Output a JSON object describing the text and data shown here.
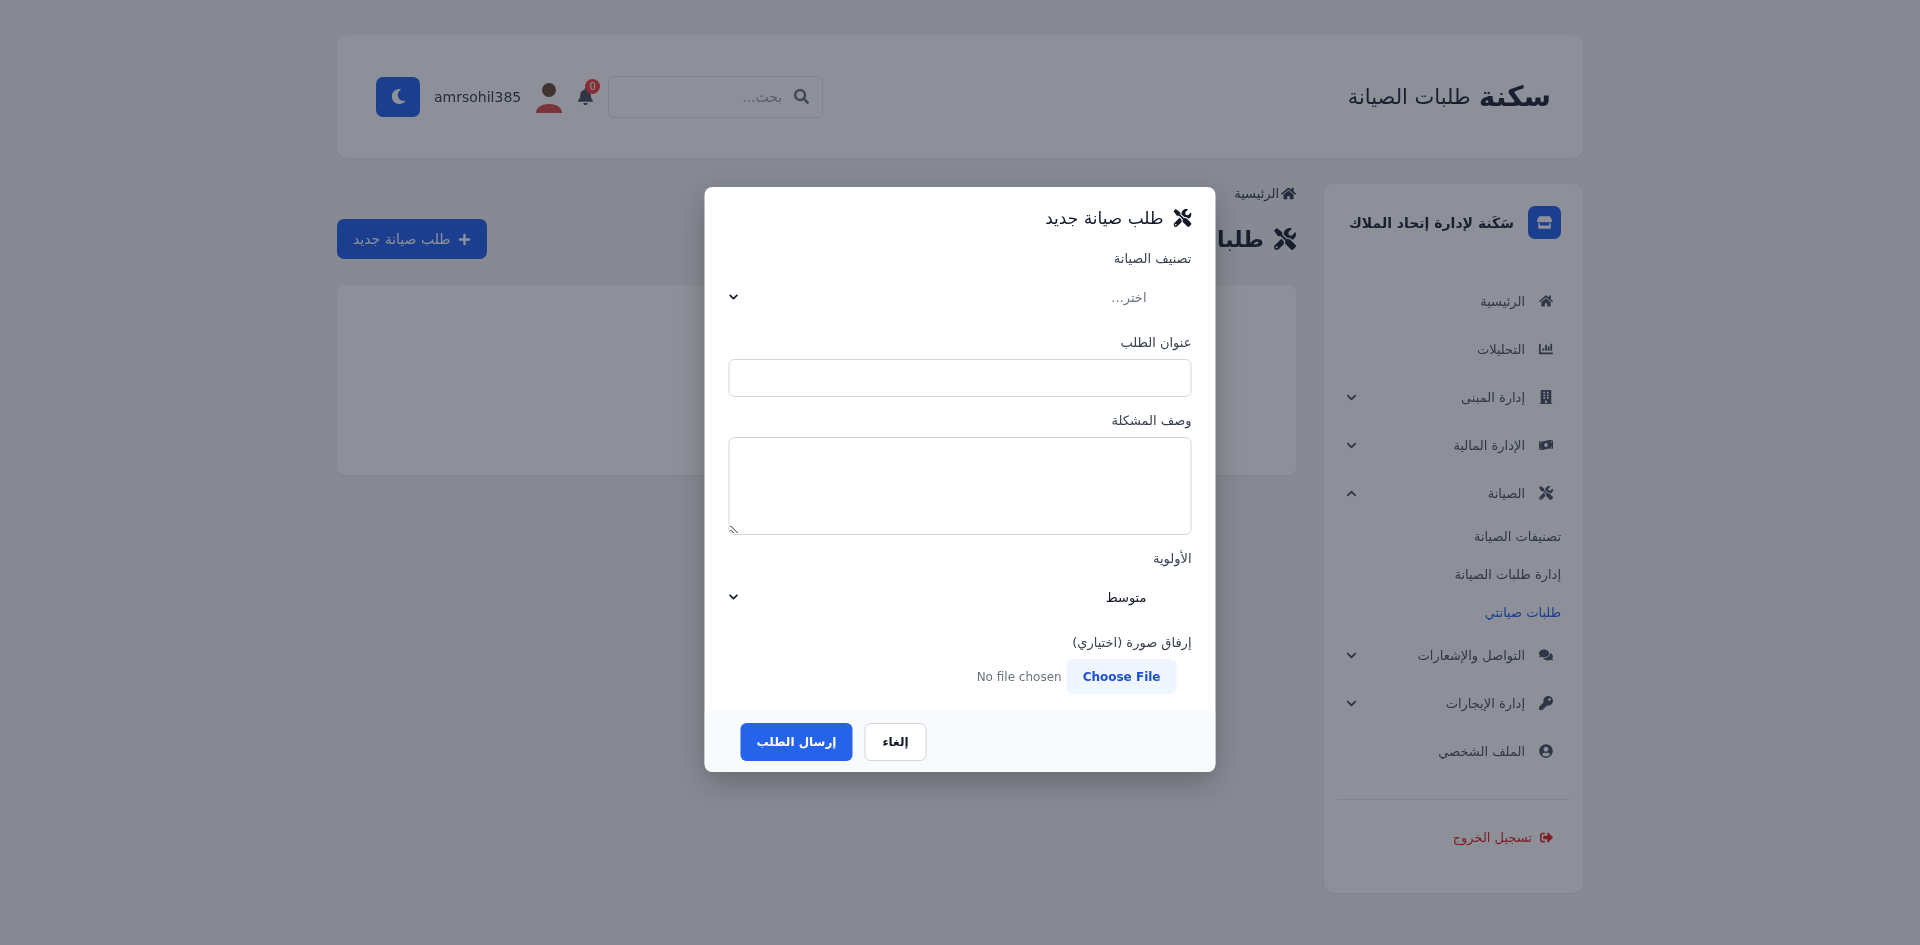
{
  "header": {
    "logo": "سكنة",
    "title": "طلبات الصيانة",
    "search": {
      "placeholder": "بحث..."
    },
    "notifications": "0",
    "username": "amrsohil385"
  },
  "sidebar": {
    "brand": "سَكَنة لإدارة إتحاد الملاك",
    "items": [
      {
        "label": "الرئيسية",
        "kind": "link",
        "selected": false
      },
      {
        "label": "التحليلات",
        "kind": "link",
        "selected": false
      },
      {
        "label": "إدارة المبنى",
        "kind": "group",
        "selected": false,
        "expanded": false
      },
      {
        "label": "الإدارة المالية",
        "kind": "group",
        "selected": false,
        "expanded": false
      },
      {
        "label": "الصيانة",
        "kind": "group",
        "selected": false,
        "expanded": true,
        "children": [
          {
            "label": "تصنيفات الصيانة",
            "selected": false
          },
          {
            "label": "إدارة طلبات الصيانة",
            "selected": false
          },
          {
            "label": "طلبات صيانتي",
            "selected": true
          }
        ]
      },
      {
        "label": "التواصل والإشعارات",
        "kind": "group",
        "selected": false,
        "expanded": false
      },
      {
        "label": "إدارة الإيجارات",
        "kind": "group",
        "selected": false,
        "expanded": false
      },
      {
        "label": "الملف الشخصي",
        "kind": "link",
        "selected": false
      }
    ],
    "logout": "تسجيل الخروج"
  },
  "breadcrumb": "الرئيسية",
  "page_title": "طلبا",
  "new_button": "طلب صيانة جديد",
  "modal": {
    "title": "طلب صيانة جديد",
    "fields": [
      {
        "kind": "select",
        "label": "تصنيف الصيانة",
        "placeholder": "اختر..."
      },
      {
        "kind": "text",
        "label": "عنوان الطلب"
      },
      {
        "kind": "textarea",
        "label": "وصف المشكلة"
      },
      {
        "kind": "select",
        "label": "الأولوية",
        "value": "متوسط"
      },
      {
        "kind": "file",
        "label": "إرفاق صورة (اختياري)",
        "button": "Choose File",
        "status": "No file chosen"
      }
    ],
    "buttons": [
      {
        "label": "إلغاء",
        "kind": "secondary"
      },
      {
        "label": "إرسال الطلب",
        "kind": "primary"
      }
    ]
  }
}
